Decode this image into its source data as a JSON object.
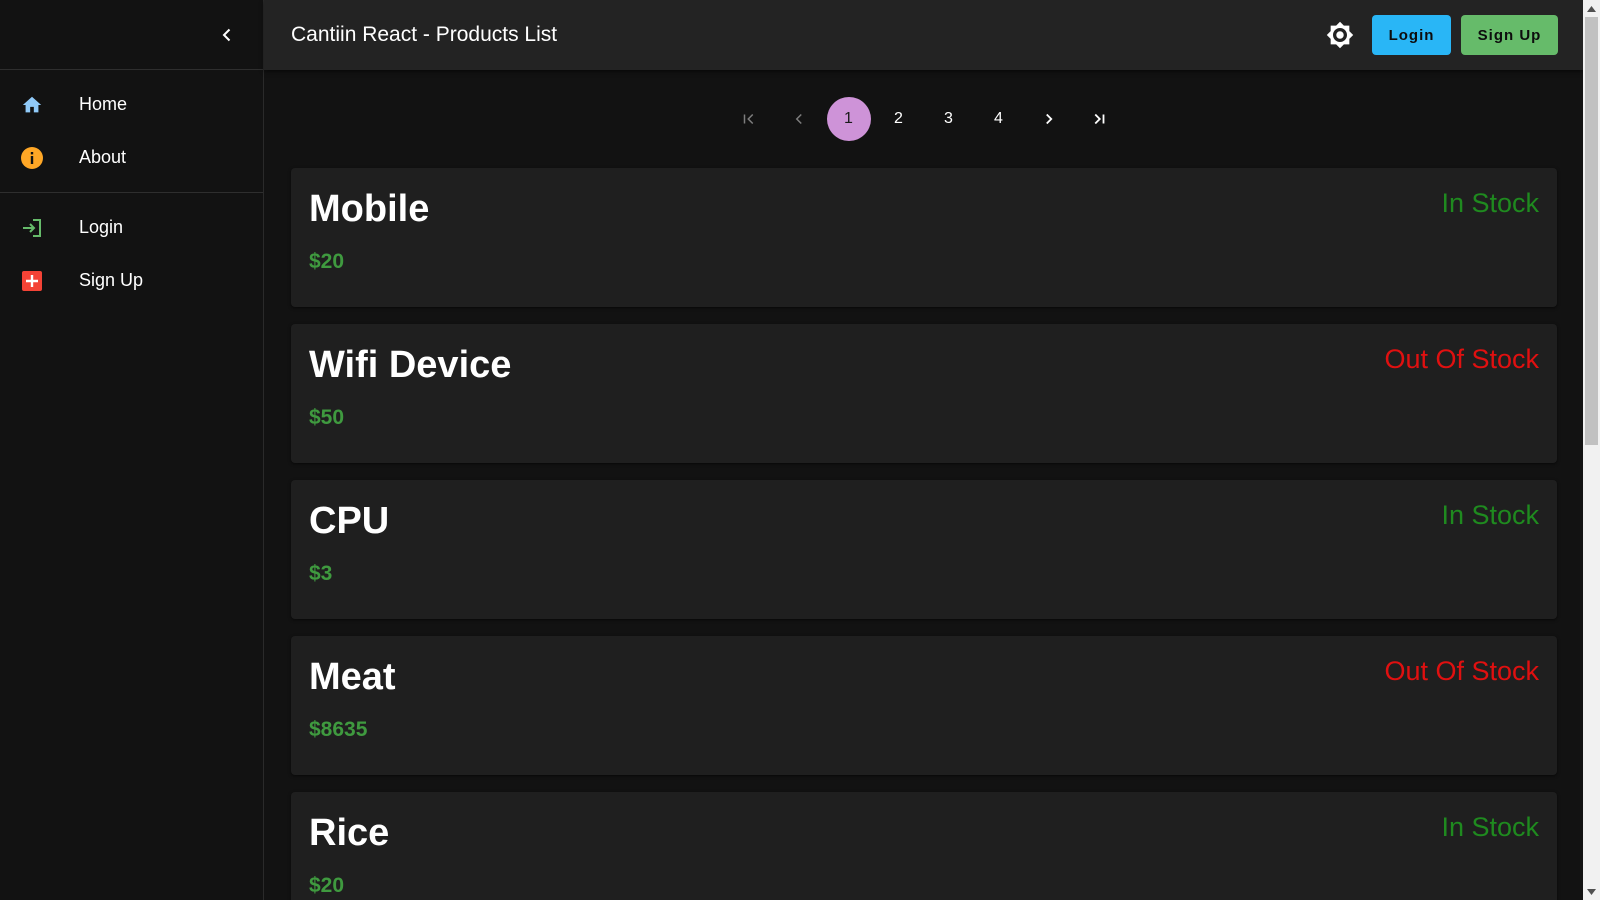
{
  "header": {
    "title": "Cantiin React - Products List",
    "login_label": "Login",
    "signup_label": "Sign Up"
  },
  "sidebar": {
    "groups": [
      [
        {
          "label": "Home",
          "icon": "home-icon",
          "color": "#90caf9"
        },
        {
          "label": "About",
          "icon": "info-icon",
          "color": "#ffa726"
        }
      ],
      [
        {
          "label": "Login",
          "icon": "login-icon",
          "color": "#66bb6a"
        },
        {
          "label": "Sign Up",
          "icon": "add-box-icon",
          "color": "#f44336"
        }
      ]
    ]
  },
  "pagination": {
    "pages": [
      "1",
      "2",
      "3",
      "4"
    ],
    "current": "1"
  },
  "products": [
    {
      "name": "Mobile",
      "price": "$20",
      "stock": "In Stock",
      "in_stock": true
    },
    {
      "name": "Wifi Device",
      "price": "$50",
      "stock": "Out Of Stock",
      "in_stock": false
    },
    {
      "name": "CPU",
      "price": "$3",
      "stock": "In Stock",
      "in_stock": true
    },
    {
      "name": "Meat",
      "price": "$8635",
      "stock": "Out Of Stock",
      "in_stock": false
    },
    {
      "name": "Rice",
      "price": "$20",
      "stock": "In Stock",
      "in_stock": true
    }
  ],
  "colors": {
    "in_stock": "#1f8a1f",
    "out_of_stock": "#e01010",
    "accent_login": "#29b6f6",
    "accent_signup": "#66bb6a",
    "page_active": "#ce93d8"
  }
}
